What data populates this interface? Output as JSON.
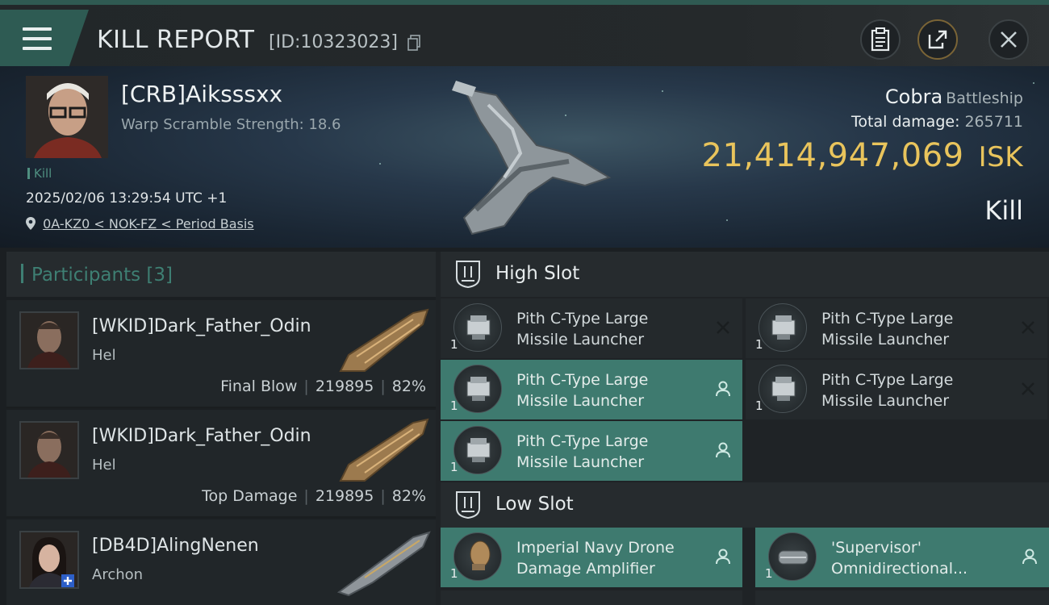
{
  "header": {
    "title": "KILL REPORT",
    "report_id": "[ID:10323023]"
  },
  "victim": {
    "name": "[CRB]Aiksssxx",
    "warp_scramble": "Warp Scramble Strength: 18.6",
    "kill_tag": "Kill",
    "timestamp": "2025/02/06 13:29:54 UTC +1",
    "location": "0A-KZ0 < NOK-FZ < Period Basis",
    "ship_name": "Cobra",
    "ship_class": "Battleship",
    "total_damage_label": "Total damage:",
    "total_damage": "265711",
    "isk_value": "21,414,947,069",
    "isk_unit": "ISK",
    "result": "Kill"
  },
  "participants": {
    "title": "Participants [3]",
    "items": [
      {
        "name": "[WKID]Dark_Father_Odin",
        "ship": "Hel",
        "role": "Final Blow",
        "damage": "219895",
        "percent": "82%"
      },
      {
        "name": "[WKID]Dark_Father_Odin",
        "ship": "Hel",
        "role": "Top Damage",
        "damage": "219895",
        "percent": "82%"
      },
      {
        "name": "[DB4D]AlingNenen",
        "ship": "Archon",
        "role": "",
        "damage": "",
        "percent": ""
      }
    ]
  },
  "slots": {
    "high_slot_label": "High Slot",
    "low_slot_label": "Low Slot",
    "high": [
      {
        "name_line1": "Pith C-Type Large",
        "name_line2": "Missile Launcher",
        "qty": "1",
        "state": "destroyed"
      },
      {
        "name_line1": "Pith C-Type Large",
        "name_line2": "Missile Launcher",
        "qty": "1",
        "state": "destroyed"
      },
      {
        "name_line1": "Pith C-Type Large",
        "name_line2": "Missile Launcher",
        "qty": "1",
        "state": "dropped"
      },
      {
        "name_line1": "Pith C-Type Large",
        "name_line2": "Missile Launcher",
        "qty": "1",
        "state": "destroyed"
      },
      {
        "name_line1": "Pith C-Type Large",
        "name_line2": "Missile Launcher",
        "qty": "1",
        "state": "dropped"
      }
    ],
    "low": [
      {
        "name_line1": "Imperial Navy Drone",
        "name_line2": "Damage Amplifier",
        "qty": "1",
        "state": "dropped"
      },
      {
        "name_line1": "'Supervisor'",
        "name_line2": "Omnidirectional...",
        "qty": "1",
        "state": "dropped"
      }
    ]
  },
  "colors": {
    "accent": "#3e7a6f",
    "isk": "#e9c45c",
    "background": "#1b1f22"
  },
  "icons": [
    "menu-icon",
    "copy-icon",
    "clipboard-icon",
    "share-icon",
    "close-icon",
    "location-pin-icon",
    "slot-shield-icon",
    "pilot-icon",
    "destroyed-x-icon"
  ]
}
